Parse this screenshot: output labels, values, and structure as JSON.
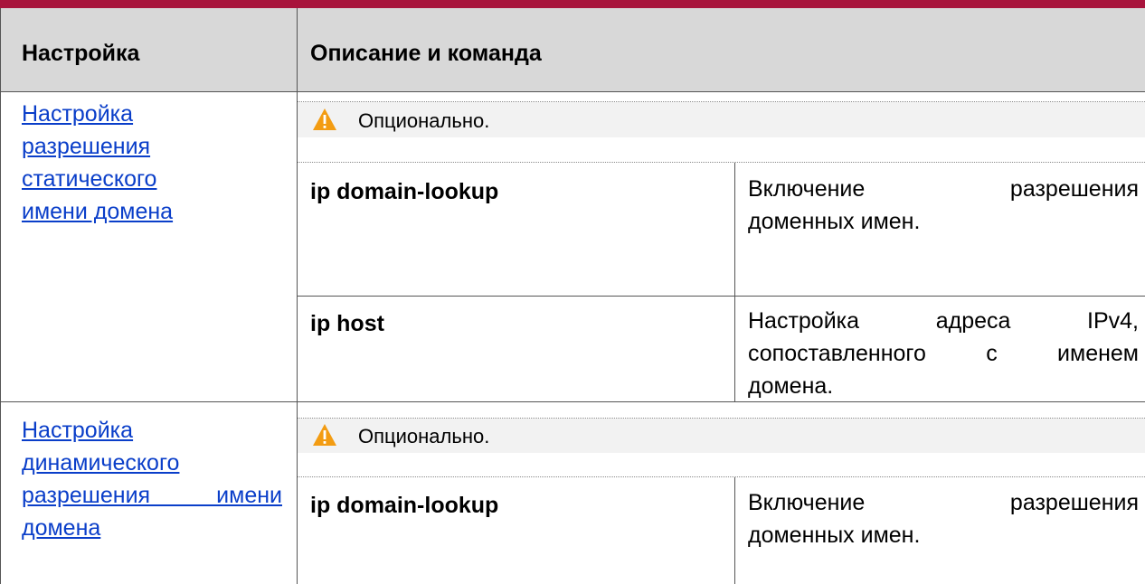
{
  "header": {
    "col1": "Настройка",
    "col2": "Описание и команда"
  },
  "sections": [
    {
      "link_lines": [
        "Настройка",
        "разрешения",
        "статического",
        "имени домена"
      ],
      "note": "Опционально.",
      "commands": [
        {
          "cmd": "ip domain-lookup",
          "desc_lines": [
            "Включение разрешения",
            "доменных имен."
          ]
        },
        {
          "cmd": "ip host",
          "desc_lines": [
            "Настройка адреса IPv4,",
            "сопоставленного с именем",
            "домена."
          ]
        }
      ]
    },
    {
      "link_lines": [
        "Настройка",
        "динамического",
        "разрешения имени",
        "домена"
      ],
      "note": "Опционально.",
      "commands": [
        {
          "cmd": "ip domain-lookup",
          "desc_lines": [
            "Включение разрешения",
            "доменных имен."
          ]
        }
      ]
    }
  ],
  "colors": {
    "top_bar": "#a8143c",
    "header_bg": "#d8d8d8",
    "link": "#0a3ec9",
    "note_bg": "#f2f2f2",
    "warning": "#f39c12"
  },
  "icons": {
    "note": "warning-icon"
  }
}
